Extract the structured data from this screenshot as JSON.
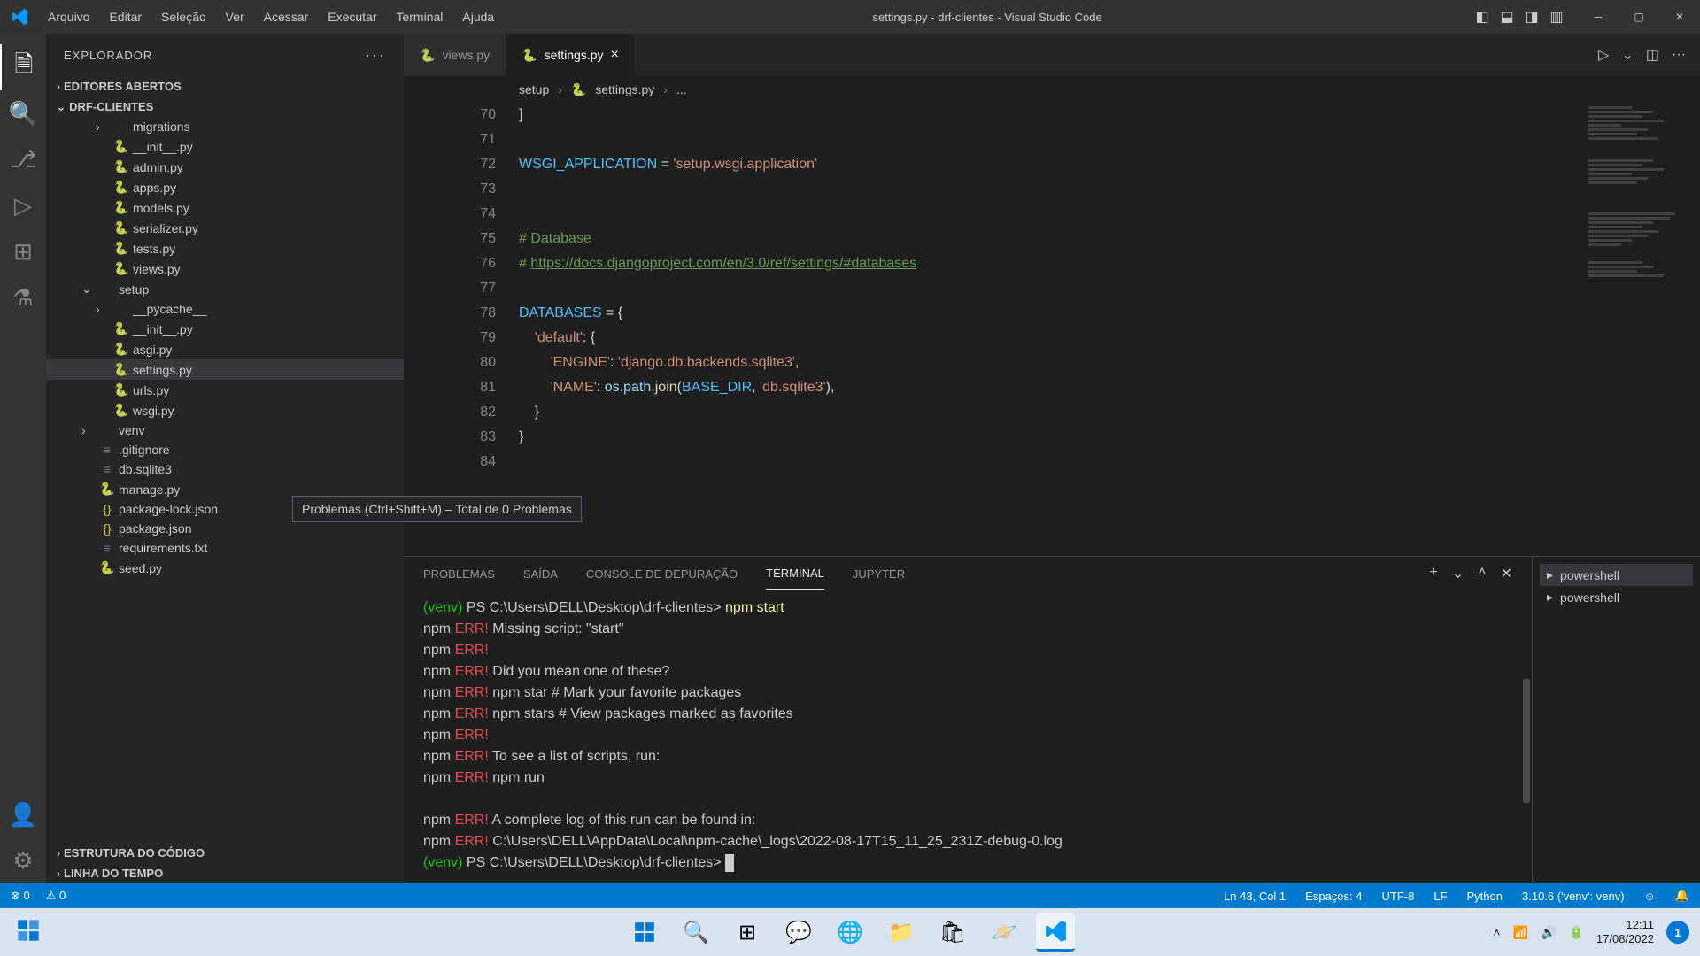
{
  "titlebar": {
    "menu": [
      "Arquivo",
      "Editar",
      "Seleção",
      "Ver",
      "Acessar",
      "Executar",
      "Terminal",
      "Ajuda"
    ],
    "title": "settings.py - drf-clientes - Visual Studio Code"
  },
  "sidebar": {
    "header": "EXPLORADOR",
    "sections": {
      "editors": "EDITORES ABERTOS",
      "project": "DRF-CLIENTES",
      "outline": "ESTRUTURA DO CÓDIGO",
      "timeline": "LINHA DO TEMPO"
    },
    "tree": [
      {
        "label": "migrations",
        "type": "folder",
        "indent": 2,
        "arrow": "›"
      },
      {
        "label": "__init__.py",
        "type": "py",
        "indent": 2
      },
      {
        "label": "admin.py",
        "type": "py",
        "indent": 2
      },
      {
        "label": "apps.py",
        "type": "py",
        "indent": 2
      },
      {
        "label": "models.py",
        "type": "py",
        "indent": 2
      },
      {
        "label": "serializer.py",
        "type": "py",
        "indent": 2
      },
      {
        "label": "tests.py",
        "type": "py",
        "indent": 2
      },
      {
        "label": "views.py",
        "type": "py",
        "indent": 2
      },
      {
        "label": "setup",
        "type": "folder",
        "indent": 1,
        "arrow": "⌄",
        "open": true
      },
      {
        "label": "__pycache__",
        "type": "folder",
        "indent": 2,
        "arrow": "›"
      },
      {
        "label": "__init__.py",
        "type": "py",
        "indent": 2
      },
      {
        "label": "asgi.py",
        "type": "py",
        "indent": 2
      },
      {
        "label": "settings.py",
        "type": "py",
        "indent": 2,
        "active": true
      },
      {
        "label": "urls.py",
        "type": "py",
        "indent": 2
      },
      {
        "label": "wsgi.py",
        "type": "py",
        "indent": 2
      },
      {
        "label": "venv",
        "type": "folder",
        "indent": 1,
        "arrow": "›"
      },
      {
        "label": ".gitignore",
        "type": "txt",
        "indent": 1
      },
      {
        "label": "db.sqlite3",
        "type": "db",
        "indent": 1
      },
      {
        "label": "manage.py",
        "type": "py",
        "indent": 1
      },
      {
        "label": "package-lock.json",
        "type": "json",
        "indent": 1
      },
      {
        "label": "package.json",
        "type": "json",
        "indent": 1
      },
      {
        "label": "requirements.txt",
        "type": "txt",
        "indent": 1
      },
      {
        "label": "seed.py",
        "type": "py",
        "indent": 1
      }
    ]
  },
  "tabs": [
    {
      "label": "views.py",
      "active": false
    },
    {
      "label": "settings.py",
      "active": true
    }
  ],
  "breadcrumb": [
    "setup",
    "settings.py",
    "..."
  ],
  "code": {
    "lines": [
      {
        "n": 70,
        "html": "]"
      },
      {
        "n": 71,
        "html": ""
      },
      {
        "n": 72,
        "html": "<span class='const'>WSGI_APPLICATION</span> = <span class='str'>'setup.wsgi.application'</span>"
      },
      {
        "n": 73,
        "html": ""
      },
      {
        "n": 74,
        "html": ""
      },
      {
        "n": 75,
        "html": "<span class='cmt'># Database</span>"
      },
      {
        "n": 76,
        "html": "<span class='cmt'># </span><span class='url'>https://docs.djangoproject.com/en/3.0/ref/settings/#databases</span>"
      },
      {
        "n": 77,
        "html": ""
      },
      {
        "n": 78,
        "html": "<span class='const'>DATABASES</span> = {"
      },
      {
        "n": 79,
        "html": "    <span class='str'>'default'</span>: {"
      },
      {
        "n": 80,
        "html": "        <span class='str'>'ENGINE'</span>: <span class='str'>'django.db.backends.sqlite3'</span>,"
      },
      {
        "n": 81,
        "html": "        <span class='str'>'NAME'</span>: <span class='var'>os</span>.<span class='var'>path</span>.<span class='fn'>join</span>(<span class='const'>BASE_DIR</span>, <span class='str'>'db.sqlite3'</span>),"
      },
      {
        "n": 82,
        "html": "    }"
      },
      {
        "n": 83,
        "html": "}"
      },
      {
        "n": 84,
        "html": ""
      }
    ]
  },
  "tooltip": "Problemas (Ctrl+Shift+M) – Total de 0 Problemas",
  "panel": {
    "tabs": [
      "PROBLEMAS",
      "SAÍDA",
      "CONSOLE DE DEPURAÇÃO",
      "TERMINAL",
      "JUPYTER"
    ],
    "active_tab": "TERMINAL",
    "terminals": [
      "powershell",
      "powershell"
    ],
    "output": [
      {
        "html": "<span class='venv'>(venv)</span> PS C:\\Users\\DELL\\Desktop\\drf-clientes> <span class='cmd'>npm start</span>"
      },
      {
        "html": "npm <span class='err'>ERR!</span> Missing script: \"start\""
      },
      {
        "html": "npm <span class='err'>ERR!</span>"
      },
      {
        "html": "npm <span class='err'>ERR!</span> Did you mean one of these?"
      },
      {
        "html": "npm <span class='err'>ERR!</span>     npm star # Mark your favorite packages"
      },
      {
        "html": "npm <span class='err'>ERR!</span>     npm stars # View packages marked as favorites"
      },
      {
        "html": "npm <span class='err'>ERR!</span>"
      },
      {
        "html": "npm <span class='err'>ERR!</span> To see a list of scripts, run:"
      },
      {
        "html": "npm <span class='err'>ERR!</span>   npm run"
      },
      {
        "html": ""
      },
      {
        "html": "npm <span class='err'>ERR!</span> A complete log of this run can be found in:"
      },
      {
        "html": "npm <span class='err'>ERR!</span>     C:\\Users\\DELL\\AppData\\Local\\npm-cache\\_logs\\2022-08-17T15_11_25_231Z-debug-0.log"
      },
      {
        "html": "<span class='venv'>(venv)</span> PS C:\\Users\\DELL\\Desktop\\drf-clientes> <span class='cursor'></span>"
      }
    ]
  },
  "statusbar": {
    "errors": "0",
    "warnings": "0",
    "position": "Ln 43, Col 1",
    "spaces": "Espaços: 4",
    "encoding": "UTF-8",
    "eol": "LF",
    "language": "Python",
    "interpreter": "3.10.6 ('venv': venv)"
  },
  "taskbar": {
    "time": "12:11",
    "date": "17/08/2022",
    "notif_count": "1"
  }
}
